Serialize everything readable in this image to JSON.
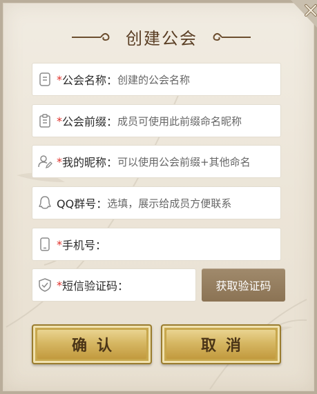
{
  "dialog": {
    "title": "创建公会"
  },
  "form": {
    "guild_name": {
      "required_mark": "*",
      "label": "公会名称：",
      "placeholder": "创建的公会名称"
    },
    "guild_prefix": {
      "required_mark": "*",
      "label": "公会前缀：",
      "placeholder": "成员可使用此前缀命名昵称"
    },
    "nickname": {
      "required_mark": "*",
      "label": "我的昵称：",
      "placeholder": "可以使用公会前缀+其他命名"
    },
    "qq_group": {
      "label": "QQ群号：",
      "placeholder": "选填，展示给成员方便联系"
    },
    "phone": {
      "required_mark": "*",
      "label": "手机号：",
      "value": ""
    },
    "sms_code": {
      "required_mark": "*",
      "label": "短信验证码：",
      "value": ""
    }
  },
  "buttons": {
    "get_code": "获取验证码",
    "confirm": "确认",
    "cancel": "取消"
  },
  "icons": {
    "guild_name": "document-icon",
    "guild_prefix": "clipboard-icon",
    "nickname": "user-edit-icon",
    "qq_group": "qq-penguin-icon",
    "phone": "phone-icon",
    "sms_code": "shield-check-icon",
    "close": "close-icon"
  },
  "colors": {
    "required": "#e0302a",
    "title": "#5a3e24",
    "gold_button": "#d6b763",
    "get_code_button": "#8b7354"
  }
}
